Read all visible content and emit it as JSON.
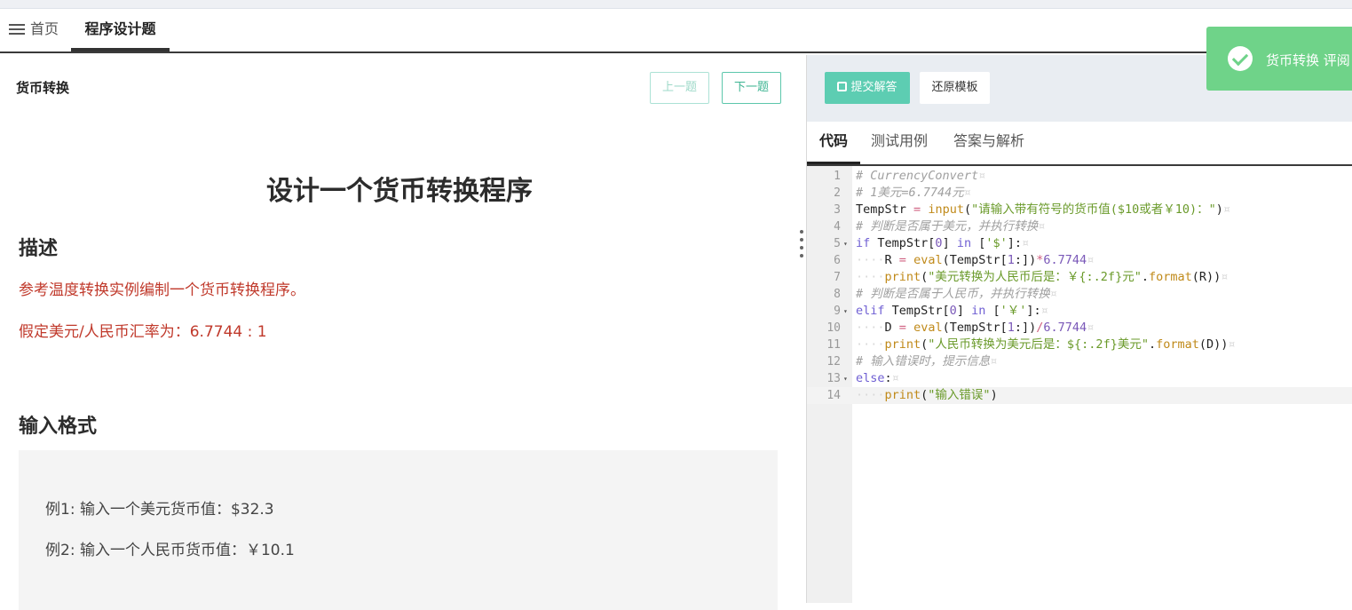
{
  "tabs": {
    "home": "首页",
    "active": "程序设计题"
  },
  "problem": {
    "name": "货币转换",
    "prev_label": "上一题",
    "next_label": "下一题",
    "heading": "设计一个货币转换程序",
    "desc_title": "描述",
    "desc_line1": "参考温度转换实例编制一个货币转换程序。",
    "desc_line2": "假定美元/人民币汇率为：6.7744 : 1",
    "fmt_title": "输入格式",
    "example1": "例1: 输入一个美元货币值：$32.3",
    "example2": "例2: 输入一个人民币货币值：￥10.1"
  },
  "toolbar": {
    "submit_label": "提交解答",
    "restore_label": "还原模板",
    "submit_icon": "save-icon"
  },
  "code_tabs": [
    "代码",
    "测试用例",
    "答案与解析"
  ],
  "toast": {
    "message": "货币转换 评阅",
    "icon": "check-circle-icon"
  },
  "colors": {
    "accent": "#5dcdb2",
    "toast": "#6fd389",
    "desc_red": "#c0392b"
  },
  "code": {
    "active_line": 14,
    "lines": [
      {
        "n": "1",
        "fold": "",
        "tokens": [
          [
            "cm",
            "# CurrencyConvert"
          ],
          [
            "ws",
            "¤"
          ]
        ]
      },
      {
        "n": "2",
        "fold": "",
        "tokens": [
          [
            "cm",
            "# 1美元=6.7744元"
          ],
          [
            "ws",
            "¤"
          ]
        ]
      },
      {
        "n": "3",
        "fold": "",
        "tokens": [
          [
            "p",
            "TempStr "
          ],
          [
            "op",
            "="
          ],
          [
            "p",
            " "
          ],
          [
            "fn",
            "input"
          ],
          [
            "p",
            "("
          ],
          [
            "str",
            "\"请输入带有符号的货币值($10或者￥10)：\""
          ],
          [
            "p",
            ")"
          ],
          [
            "ws",
            "¤"
          ]
        ]
      },
      {
        "n": "4",
        "fold": "",
        "tokens": [
          [
            "cm",
            "# 判断是否属于美元，并执行转换"
          ],
          [
            "ws",
            "¤"
          ]
        ]
      },
      {
        "n": "5",
        "fold": "▾",
        "tokens": [
          [
            "kw",
            "if"
          ],
          [
            "p",
            " TempStr["
          ],
          [
            "num",
            "0"
          ],
          [
            "p",
            "] "
          ],
          [
            "kw",
            "in"
          ],
          [
            "p",
            " ["
          ],
          [
            "str",
            "'$'"
          ],
          [
            "p",
            "]:"
          ],
          [
            "ws",
            "¤"
          ]
        ]
      },
      {
        "n": "6",
        "fold": "",
        "tokens": [
          [
            "ws",
            "····"
          ],
          [
            "p",
            "R "
          ],
          [
            "op",
            "="
          ],
          [
            "p",
            " "
          ],
          [
            "fn",
            "eval"
          ],
          [
            "p",
            "(TempStr["
          ],
          [
            "num",
            "1"
          ],
          [
            "p",
            ":])"
          ],
          [
            "op",
            "*"
          ],
          [
            "num",
            "6.7744"
          ],
          [
            "ws",
            "¤"
          ]
        ]
      },
      {
        "n": "7",
        "fold": "",
        "tokens": [
          [
            "ws",
            "····"
          ],
          [
            "fn",
            "print"
          ],
          [
            "p",
            "("
          ],
          [
            "str",
            "\"美元转换为人民币后是：￥{:.2f}元\""
          ],
          [
            "p",
            "."
          ],
          [
            "fn",
            "format"
          ],
          [
            "p",
            "(R))"
          ],
          [
            "ws",
            "¤"
          ]
        ]
      },
      {
        "n": "8",
        "fold": "",
        "tokens": [
          [
            "cm",
            "# 判断是否属于人民币，并执行转换"
          ],
          [
            "ws",
            "¤"
          ]
        ]
      },
      {
        "n": "9",
        "fold": "▾",
        "tokens": [
          [
            "kw",
            "elif"
          ],
          [
            "p",
            " TempStr["
          ],
          [
            "num",
            "0"
          ],
          [
            "p",
            "] "
          ],
          [
            "kw",
            "in"
          ],
          [
            "p",
            " ["
          ],
          [
            "str",
            "'￥'"
          ],
          [
            "p",
            "]:"
          ],
          [
            "ws",
            "¤"
          ]
        ]
      },
      {
        "n": "10",
        "fold": "",
        "tokens": [
          [
            "ws",
            "····"
          ],
          [
            "p",
            "D "
          ],
          [
            "op",
            "="
          ],
          [
            "p",
            " "
          ],
          [
            "fn",
            "eval"
          ],
          [
            "p",
            "(TempStr["
          ],
          [
            "num",
            "1"
          ],
          [
            "p",
            ":])"
          ],
          [
            "op",
            "/"
          ],
          [
            "num",
            "6.7744"
          ],
          [
            "ws",
            "¤"
          ]
        ]
      },
      {
        "n": "11",
        "fold": "",
        "tokens": [
          [
            "ws",
            "····"
          ],
          [
            "fn",
            "print"
          ],
          [
            "p",
            "("
          ],
          [
            "str",
            "\"人民币转换为美元后是：${:.2f}美元\""
          ],
          [
            "p",
            "."
          ],
          [
            "fn",
            "format"
          ],
          [
            "p",
            "(D))"
          ],
          [
            "ws",
            "¤"
          ]
        ]
      },
      {
        "n": "12",
        "fold": "",
        "tokens": [
          [
            "cm",
            "# 输入错误时，提示信息"
          ],
          [
            "ws",
            "¤"
          ]
        ]
      },
      {
        "n": "13",
        "fold": "▾",
        "tokens": [
          [
            "kw",
            "else"
          ],
          [
            "p",
            ":"
          ],
          [
            "ws",
            "¤"
          ]
        ]
      },
      {
        "n": "14",
        "fold": "",
        "tokens": [
          [
            "ws",
            "····"
          ],
          [
            "fn",
            "print"
          ],
          [
            "p",
            "("
          ],
          [
            "str",
            "\"输入错误\""
          ],
          [
            "p",
            ")"
          ]
        ]
      }
    ]
  }
}
